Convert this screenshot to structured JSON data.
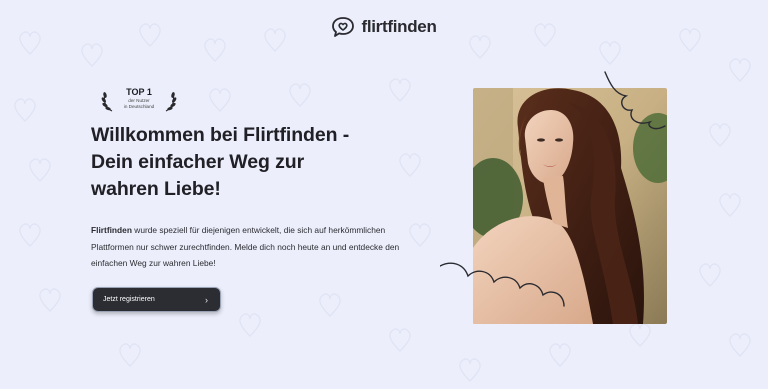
{
  "header": {
    "logo_text": "flirtfinden",
    "logo_icon": "chat-heart-icon"
  },
  "award": {
    "title": "TOP 1",
    "line1": "der Nutzer",
    "line2": "in Deutschland",
    "icon": "laurel-wreath-icon"
  },
  "hero": {
    "headline_line1": "Willkommen bei Flirtfinden -",
    "headline_line2": "Dein einfacher Weg zur",
    "headline_line3": "wahren Liebe!",
    "desc_brand": "Flirtfinden",
    "desc_rest": " wurde speziell für diejenigen entwickelt, die sich auf herkömmlichen Plattformen nur schwer zurechtfinden. Melde dich noch heute an und entdecke den einfachen Weg zur wahren Liebe!"
  },
  "cta": {
    "label": "Jetzt registrieren",
    "icon": "chevron-right-icon"
  },
  "colors": {
    "background": "#eceffb",
    "button": "#2b2d33",
    "text": "#1f1f24"
  }
}
